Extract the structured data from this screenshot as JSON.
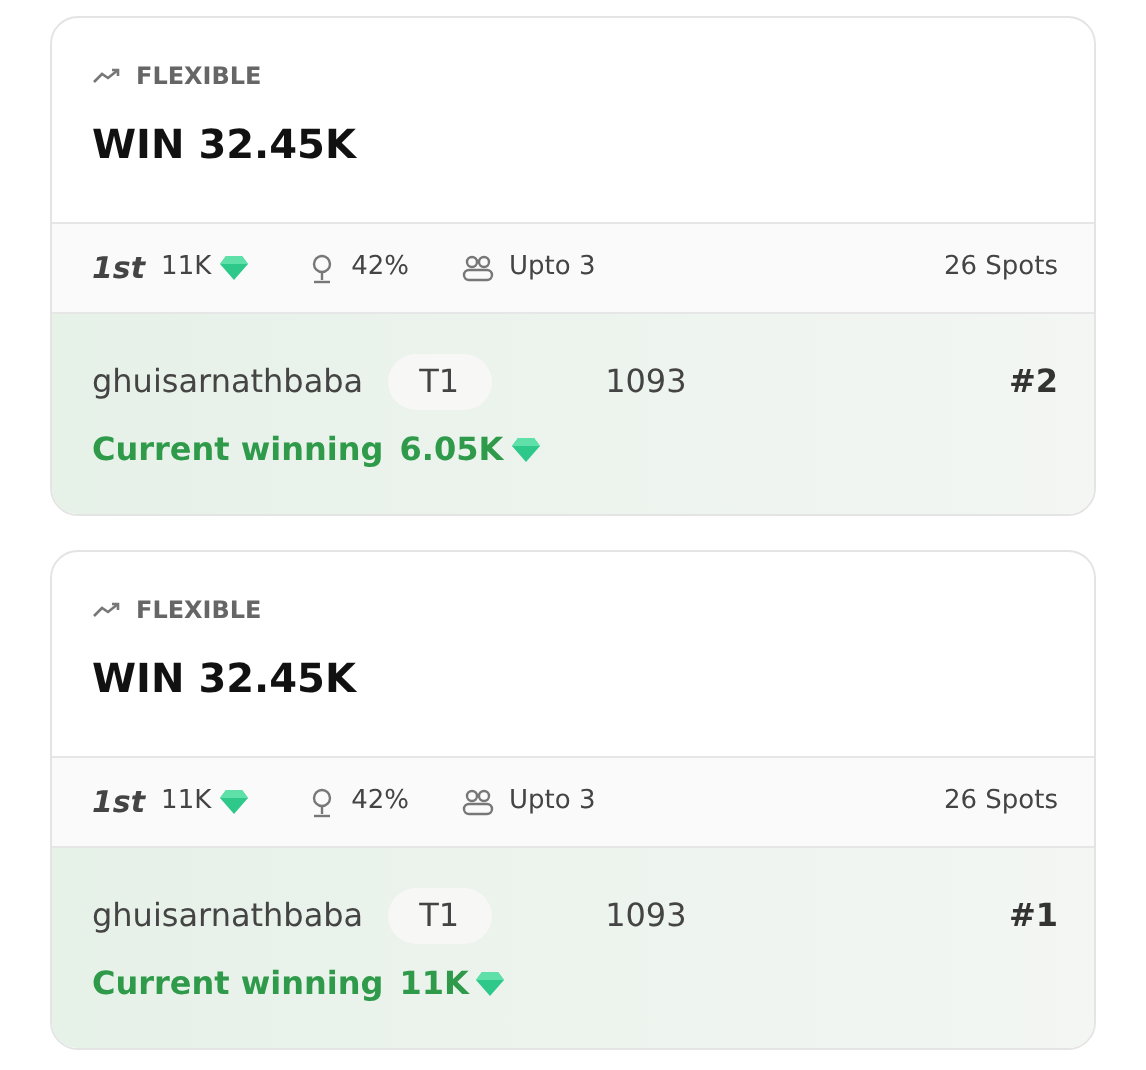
{
  "contests": [
    {
      "type_label": "FLEXIBLE",
      "title": "WIN 32.45K",
      "first_label": "1st",
      "first_prize": "11K",
      "win_percent": "42%",
      "team_limit": "Upto 3",
      "spots": "26 Spots",
      "entry": {
        "username": "ghuisarnathbaba",
        "team": "T1",
        "points": "1093",
        "rank": "#2",
        "winning_label": "Current winning",
        "winning_amount": "6.05K"
      }
    },
    {
      "type_label": "FLEXIBLE",
      "title": "WIN 32.45K",
      "first_label": "1st",
      "first_prize": "11K",
      "win_percent": "42%",
      "team_limit": "Upto 3",
      "spots": "26 Spots",
      "entry": {
        "username": "ghuisarnathbaba",
        "team": "T1",
        "points": "1093",
        "rank": "#1",
        "winning_label": "Current winning",
        "winning_amount": "11K"
      }
    }
  ]
}
